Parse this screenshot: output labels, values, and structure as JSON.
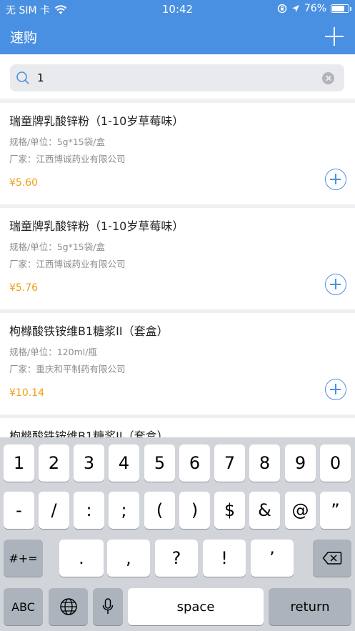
{
  "status_bar": {
    "carrier": "无 SIM 卡",
    "time": "10:42",
    "battery": "76%",
    "battery_level": 0.76
  },
  "nav": {
    "title": "速购",
    "add_icon": "plus-icon"
  },
  "search": {
    "value": "1",
    "icon": "search-icon"
  },
  "products": [
    {
      "name": "瑞童牌乳酸锌粉（1-10岁草莓味）",
      "spec": "规格/单位：5g*15袋/盒",
      "maker": "厂家：江西博诚药业有限公司",
      "price": "¥5.60"
    },
    {
      "name": "瑞童牌乳酸锌粉（1-10岁草莓味）",
      "spec": "规格/单位：5g*15袋/盒",
      "maker": "厂家：江西博诚药业有限公司",
      "price": "¥5.76"
    },
    {
      "name": "枸橼酸铁铵维B1糖浆II（套盒）",
      "spec": "规格/单位：120ml/瓶",
      "maker": "厂家：重庆和平制药有限公司",
      "price": "¥10.14"
    },
    {
      "name": "枸橼酸铁铵维B1糖浆II（套盒）",
      "spec": "",
      "maker": "",
      "price": ""
    }
  ],
  "keyboard": {
    "row1": [
      "1",
      "2",
      "3",
      "4",
      "5",
      "6",
      "7",
      "8",
      "9",
      "0"
    ],
    "row2": [
      "-",
      "/",
      ":",
      ";",
      "(",
      ")",
      "$",
      "&",
      "@",
      "”"
    ],
    "row3_mode": "#+=",
    "row3": [
      ".",
      ",",
      "?",
      "!",
      "’"
    ],
    "abc": "ABC",
    "space": "space",
    "return": "return"
  },
  "colors": {
    "accent": "#4a90e2",
    "price": "#f39c12"
  }
}
